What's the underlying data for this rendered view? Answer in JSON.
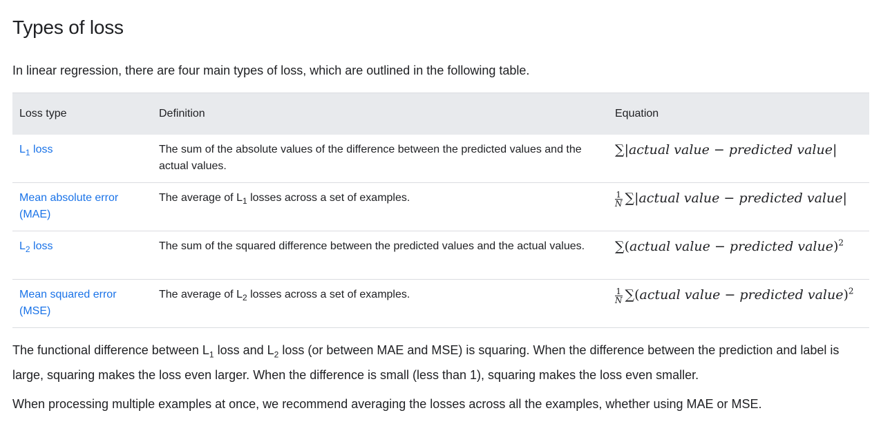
{
  "heading": "Types of loss",
  "intro": "In linear regression, there are four main types of loss, which are outlined in the following table.",
  "table": {
    "headers": [
      "Loss type",
      "Definition",
      "Equation"
    ],
    "rows": [
      {
        "type_base": "L",
        "type_sub": "1",
        "type_suffix": " loss",
        "def_pre": "The sum of the absolute values of the difference between the predicted values and the actual values.",
        "def_sub": "",
        "def_post": "",
        "eq_frac": false,
        "eq_open": "|",
        "eq_close": "|",
        "eq_sup": ""
      },
      {
        "type_base": "Mean absolute error (MAE)",
        "type_sub": "",
        "type_suffix": "",
        "def_pre": "The average of L",
        "def_sub": "1",
        "def_post": " losses across a set of examples.",
        "eq_frac": true,
        "eq_open": "|",
        "eq_close": "|",
        "eq_sup": ""
      },
      {
        "type_base": "L",
        "type_sub": "2",
        "type_suffix": " loss",
        "def_pre": "The sum of the squared difference between the predicted values and the actual values.",
        "def_sub": "",
        "def_post": "",
        "eq_frac": false,
        "eq_open": "(",
        "eq_close": ")",
        "eq_sup": "2"
      },
      {
        "type_base": "Mean squared error (MSE)",
        "type_sub": "",
        "type_suffix": "",
        "def_pre": "The average of L",
        "def_sub": "2",
        "def_post": " losses across a set of examples.",
        "eq_frac": true,
        "eq_open": "(",
        "eq_close": ")",
        "eq_sup": "2"
      }
    ],
    "eq_text": {
      "sigma": "∑",
      "actual": "actual value",
      "minus": " − ",
      "predicted": "predicted value",
      "frac_num": "1",
      "frac_den": "N"
    }
  },
  "para1": {
    "p1": "The functional difference between L",
    "s1": "1",
    "p2": " loss and L",
    "s2": "2",
    "p3": " loss (or between MAE and MSE) is squaring. When the difference between the prediction and label is large, squaring makes the loss even larger. When the difference is small (less than 1), squaring makes the loss even smaller."
  },
  "para2": "When processing multiple examples at once, we recommend averaging the losses across all the examples, whether using MAE or MSE.",
  "colors": {
    "link": "#1a73e8",
    "header_bg": "#e8eaed",
    "text": "#202124",
    "divider": "#dadce0"
  }
}
